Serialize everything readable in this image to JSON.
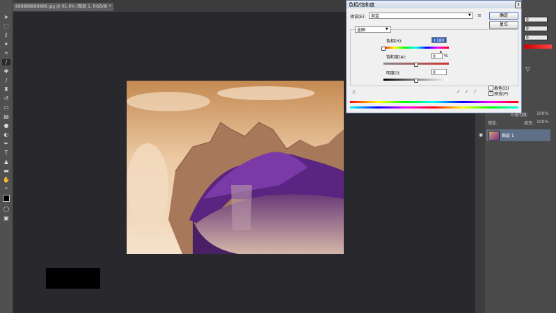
{
  "document": {
    "tab_title": "888888888888.jpg @ 61.6% (图层 1, RGB/8) *"
  },
  "dialog": {
    "title": "色相/饱和度",
    "close_glyph": "x",
    "preset_label": "预设(E):",
    "preset_value": "自定",
    "ok_label": "确定",
    "reset_label": "复位",
    "edit_value": "全图",
    "hue_label": "色相(H):",
    "hue_value": "+180",
    "saturation_label": "饱和度(A):",
    "saturation_value": "0",
    "percent_sign": "%",
    "lightness_label": "明度(I):",
    "lightness_value": "0",
    "colorize_label": "着色(O)",
    "preview_label": "预览(P)",
    "preview_check": "✓",
    "hue_position": 0.0,
    "saturation_position": 0.5,
    "lightness_position": 0.5
  },
  "right_panel": {
    "opacity_label": "不透明度:",
    "opacity_value": "100%",
    "fill_label": "填充:",
    "fill_value": "100%",
    "layer_name": "图层 1",
    "field_values": [
      "0",
      "0",
      "0"
    ],
    "lock_label": "锁定:"
  },
  "colors": {
    "toolbar": "#505050",
    "canvas_bg": "#29282d",
    "dialog_bg": "#f0f0f0",
    "layer_selected": "#5e6f86"
  }
}
